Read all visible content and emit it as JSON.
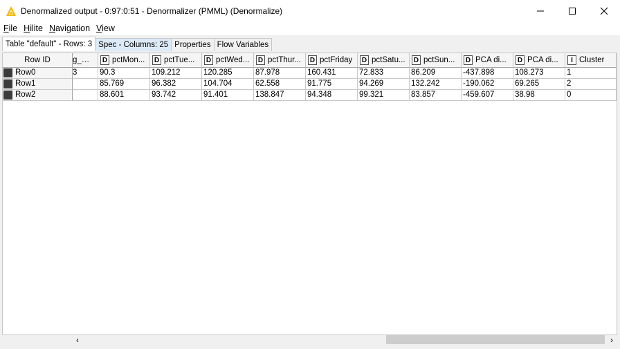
{
  "window": {
    "title": "Denormalized output - 0:97:0:51 - Denormalizer (PMML) (Denormalize)",
    "app_icon": "knime-warning-triangle-icon",
    "controls": [
      "minimize-icon",
      "maximize-icon",
      "close-icon"
    ]
  },
  "menu": {
    "file": {
      "mnemonic": "F",
      "rest": "ile"
    },
    "hilite": {
      "mnemonic": "H",
      "rest": "ilite"
    },
    "navigation": {
      "mnemonic": "N",
      "rest": "avigation"
    },
    "view": {
      "mnemonic": "V",
      "rest": "iew"
    }
  },
  "tabs": {
    "table": "Table \"default\" - Rows: 3",
    "spec": "Spec - Columns: 25",
    "properties": "Properties",
    "flow_variables": "Flow Variables"
  },
  "table": {
    "row_id_header": "Row ID",
    "partial_column": {
      "name": "g_WE",
      "cells": [
        "3",
        "",
        ""
      ]
    },
    "columns": [
      {
        "type": "D",
        "name": "pctMon..."
      },
      {
        "type": "D",
        "name": "pctTue..."
      },
      {
        "type": "D",
        "name": "pctWed..."
      },
      {
        "type": "D",
        "name": "pctThur..."
      },
      {
        "type": "D",
        "name": "pctFriday"
      },
      {
        "type": "D",
        "name": "pctSatu..."
      },
      {
        "type": "D",
        "name": "pctSun..."
      },
      {
        "type": "D",
        "name": "PCA di..."
      },
      {
        "type": "D",
        "name": "PCA di..."
      },
      {
        "type": "I",
        "name": "Cluster"
      }
    ],
    "rows": [
      {
        "id": "Row0",
        "cells": [
          "90.3",
          "109.212",
          "120.285",
          "87.978",
          "160.431",
          "72.833",
          "86.209",
          "-437.898",
          "108.273",
          "1"
        ]
      },
      {
        "id": "Row1",
        "cells": [
          "85.769",
          "96.382",
          "104.704",
          "62.558",
          "91.775",
          "94.269",
          "132.242",
          "-190.062",
          "69.265",
          "2"
        ]
      },
      {
        "id": "Row2",
        "cells": [
          "88.601",
          "93.742",
          "91.401",
          "138.847",
          "94.348",
          "99.321",
          "83.857",
          "-459.607",
          "38.98",
          "0"
        ]
      }
    ]
  },
  "scrollbar": {
    "left_arrow": "‹",
    "right_arrow": "›",
    "thumb_start_fraction": 0.58,
    "thumb_size_fraction": 0.4
  }
}
